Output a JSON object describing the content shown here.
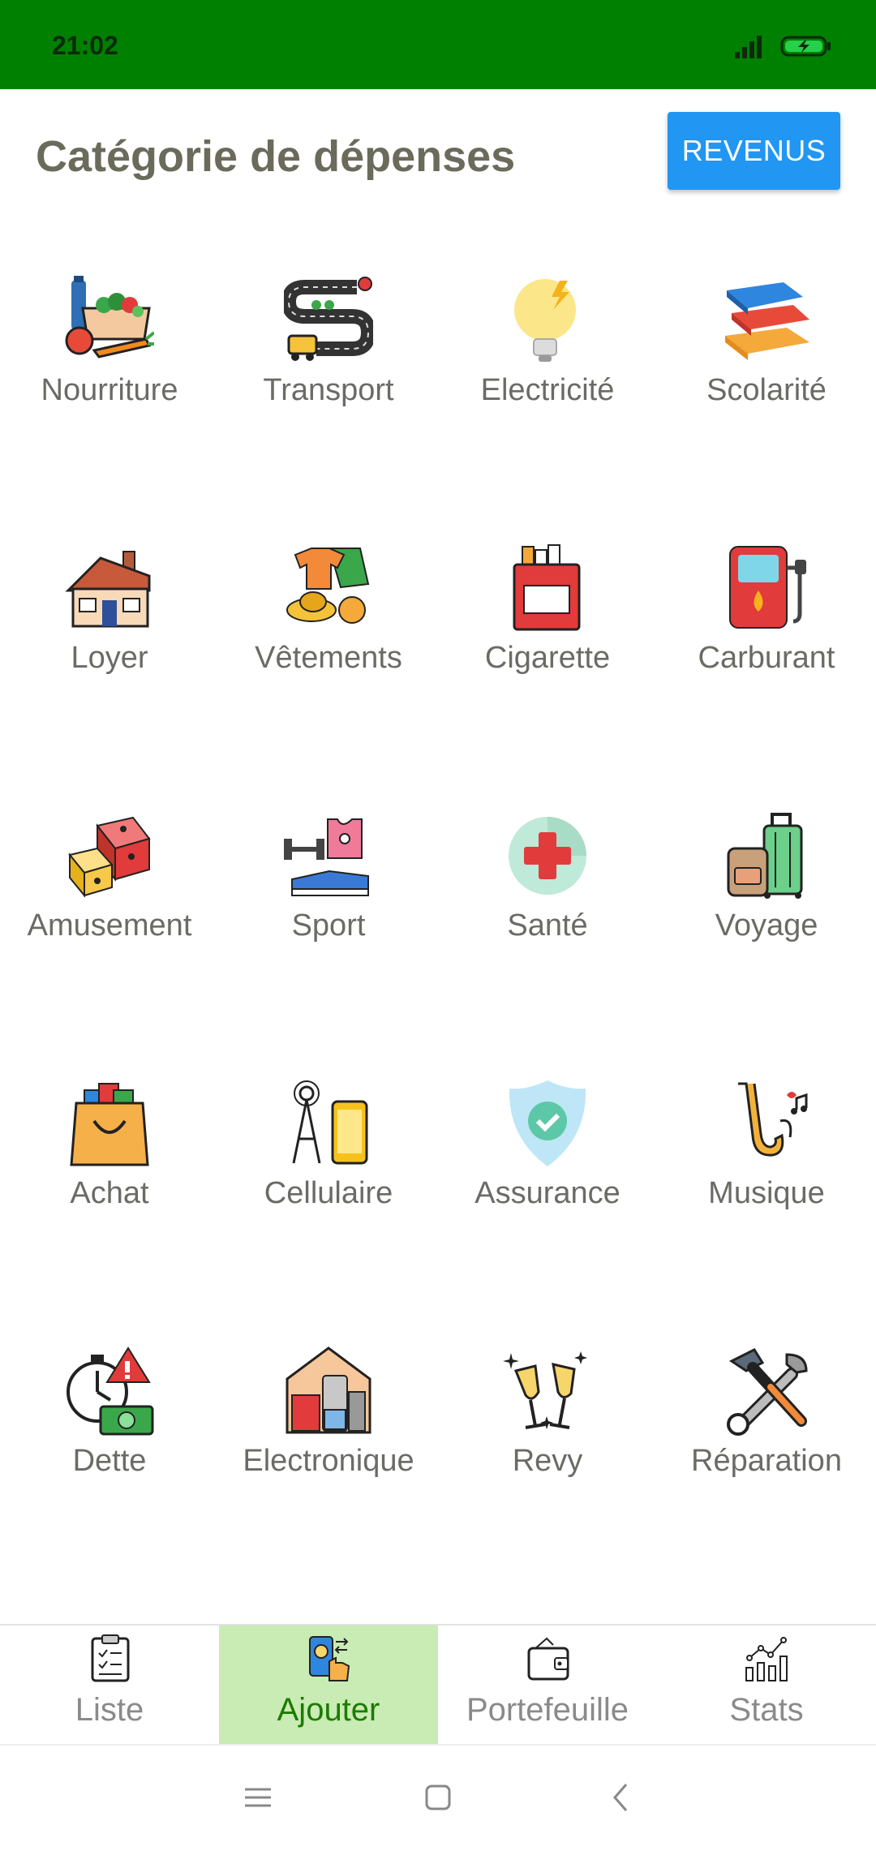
{
  "status_bar": {
    "time": "21:02",
    "bg_color": "#008000"
  },
  "header": {
    "title": "Catégorie de dépenses",
    "revenus_label": "REVENUS"
  },
  "categories": [
    {
      "label": "Nourriture",
      "icon": "food-icon"
    },
    {
      "label": "Transport",
      "icon": "transport-icon"
    },
    {
      "label": "Electricité",
      "icon": "lightbulb-icon"
    },
    {
      "label": "Scolarité",
      "icon": "books-icon"
    },
    {
      "label": "Loyer",
      "icon": "house-icon"
    },
    {
      "label": "Vêtements",
      "icon": "clothes-icon"
    },
    {
      "label": "Cigarette",
      "icon": "cigarette-pack-icon"
    },
    {
      "label": "Carburant",
      "icon": "fuel-pump-icon"
    },
    {
      "label": "Amusement",
      "icon": "dice-icon"
    },
    {
      "label": "Sport",
      "icon": "sport-icon"
    },
    {
      "label": "Santé",
      "icon": "medical-cross-icon"
    },
    {
      "label": "Voyage",
      "icon": "luggage-icon"
    },
    {
      "label": "Achat",
      "icon": "shopping-bag-icon"
    },
    {
      "label": "Cellulaire",
      "icon": "cellphone-icon"
    },
    {
      "label": "Assurance",
      "icon": "shield-icon"
    },
    {
      "label": "Musique",
      "icon": "saxophone-icon"
    },
    {
      "label": "Dette",
      "icon": "stopwatch-money-icon"
    },
    {
      "label": "Electronique",
      "icon": "appliances-icon"
    },
    {
      "label": "Revy",
      "icon": "champagne-icon"
    },
    {
      "label": "Réparation",
      "icon": "tools-icon"
    }
  ],
  "bottom_nav": [
    {
      "label": "Liste",
      "icon": "clipboard-icon",
      "active": false
    },
    {
      "label": "Ajouter",
      "icon": "add-payment-icon",
      "active": true
    },
    {
      "label": "Portefeuille",
      "icon": "wallet-icon",
      "active": false
    },
    {
      "label": "Stats",
      "icon": "stats-icon",
      "active": false
    }
  ],
  "colors": {
    "accent": "#2196F3",
    "active_tab_bg": "#c8ecb4",
    "active_tab_text": "#1e7a00"
  }
}
